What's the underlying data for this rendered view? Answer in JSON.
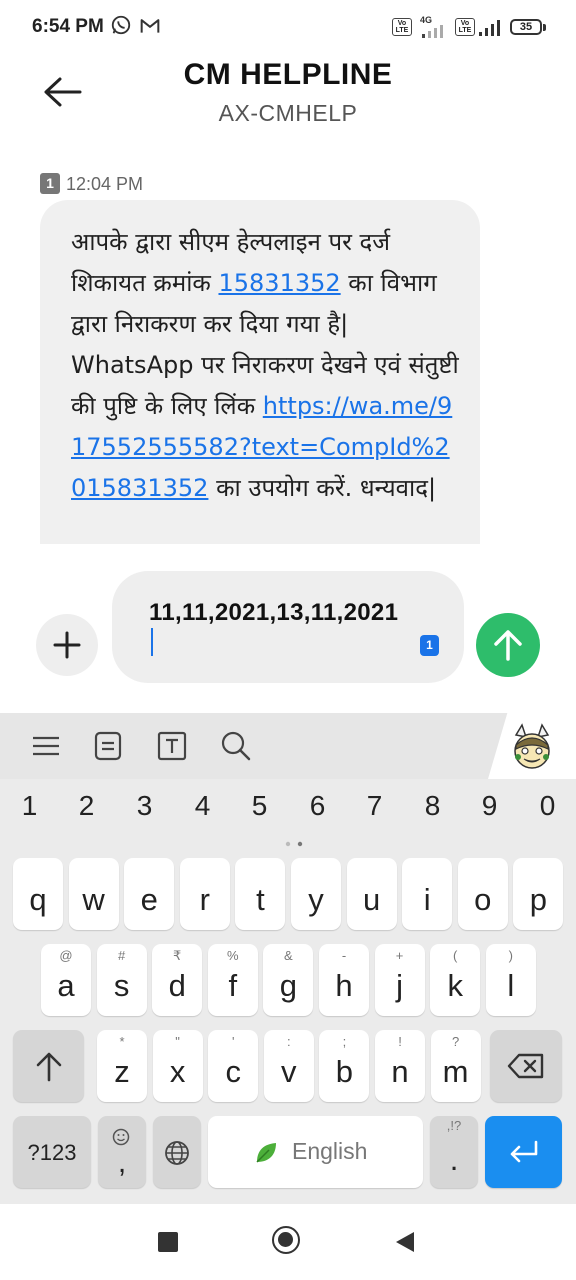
{
  "status_bar": {
    "time": "6:54 PM",
    "battery": "35",
    "network": "4G",
    "volte": "Vo\nLTE"
  },
  "header": {
    "title": "CM HELPLINE",
    "subtitle": "AX-CMHELP"
  },
  "message": {
    "sim_label": "1",
    "time": "12:04 PM",
    "text_parts": {
      "p1": "आपके द्वारा सीएम हेल्पलाइन पर दर्ज शिकायत क्रमांक ",
      "link_number": "15831352",
      "p2": " का विभाग द्वारा निराकरण कर दिया गया है| WhatsApp पर निराकरण देखने एवं संतुष्टी की पुष्टि के लिए लिंक ",
      "link_url": "https://wa.me/917552555582?text=CompId%2015831352",
      "p3": " का उपयोग करें. धन्यवाद|"
    }
  },
  "compose": {
    "value": "11,11,2021,13,11,2021",
    "sim_label": "1"
  },
  "keyboard": {
    "numbers": [
      "1",
      "2",
      "3",
      "4",
      "5",
      "6",
      "7",
      "8",
      "9",
      "0"
    ],
    "row1": [
      {
        "k": "q"
      },
      {
        "k": "w"
      },
      {
        "k": "e"
      },
      {
        "k": "r"
      },
      {
        "k": "t"
      },
      {
        "k": "y"
      },
      {
        "k": "u"
      },
      {
        "k": "i"
      },
      {
        "k": "o"
      },
      {
        "k": "p"
      }
    ],
    "row2": [
      {
        "k": "a",
        "h": "@"
      },
      {
        "k": "s",
        "h": "#"
      },
      {
        "k": "d",
        "h": "₹"
      },
      {
        "k": "f",
        "h": "%"
      },
      {
        "k": "g",
        "h": "&"
      },
      {
        "k": "h",
        "h": "-"
      },
      {
        "k": "j",
        "h": "+"
      },
      {
        "k": "k",
        "h": "("
      },
      {
        "k": "l",
        "h": ")"
      }
    ],
    "row3": [
      {
        "k": "z",
        "h": "*"
      },
      {
        "k": "x",
        "h": "\""
      },
      {
        "k": "c",
        "h": "'"
      },
      {
        "k": "v",
        "h": ":"
      },
      {
        "k": "b",
        "h": ";"
      },
      {
        "k": "n",
        "h": "!"
      },
      {
        "k": "m",
        "h": "?"
      }
    ],
    "symbols_label": "?123",
    "comma_label": ",",
    "space_label": "English",
    "period_label": ".",
    "period_hint": ",!?"
  }
}
